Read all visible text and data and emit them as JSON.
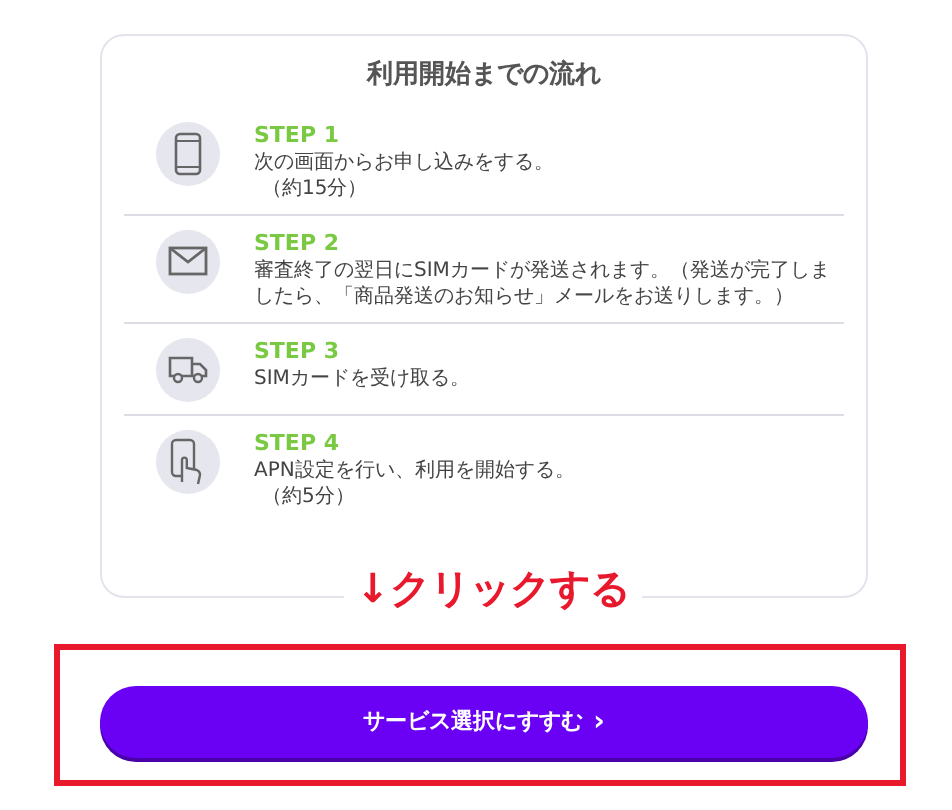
{
  "card": {
    "title": "利用開始までの流れ",
    "steps": [
      {
        "label": "STEP 1",
        "description": "次の画面からお申し込みをする。",
        "note": "（約15分）"
      },
      {
        "label": "STEP 2",
        "description": "審査終了の翌日にSIMカードが発送されます。（発送が完了しましたら、「商品発送のお知らせ」メールをお送りします。）"
      },
      {
        "label": "STEP 3",
        "description": "SIMカードを受け取る。"
      },
      {
        "label": "STEP 4",
        "description": "APN設定を行い、利用を開始する。",
        "note": "（約5分）"
      }
    ]
  },
  "annotation": "↓クリックする",
  "button": {
    "label": "サービス選択にすすむ",
    "chevron": "›"
  }
}
